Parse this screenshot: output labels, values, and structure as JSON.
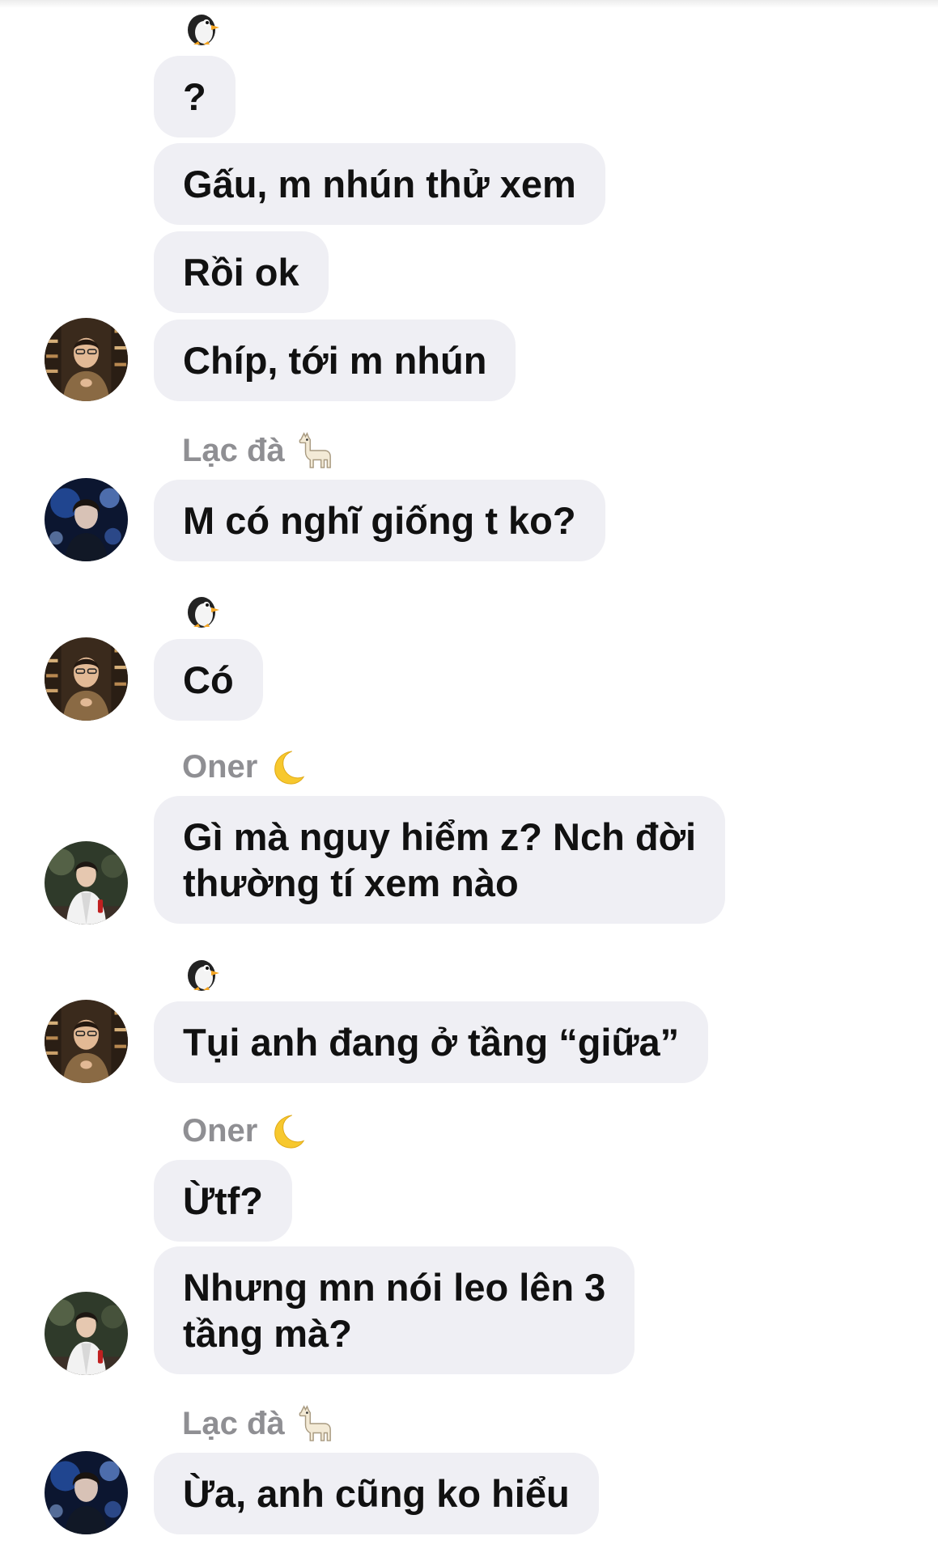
{
  "conversation": {
    "groups": [
      {
        "sender": {
          "name": "",
          "emoji": "penguin-icon"
        },
        "messages": [
          {
            "text": "?"
          },
          {
            "text": "Gấu, m nhún thử xem"
          },
          {
            "text": "Rồi ok"
          },
          {
            "text": "Chíp, tới m nhún"
          }
        ],
        "avatar": "brown-sweater-avatar"
      },
      {
        "sender": {
          "name": "Lạc đà",
          "emoji": "llama-icon"
        },
        "messages": [
          {
            "text": "M có nghĩ giống t ko?"
          }
        ],
        "avatar": "blue-light-avatar"
      },
      {
        "sender": {
          "name": "",
          "emoji": "penguin-icon"
        },
        "messages": [
          {
            "text": "Có"
          }
        ],
        "avatar": "brown-sweater-avatar"
      },
      {
        "sender": {
          "name": "Oner",
          "emoji": "crescent-moon-icon"
        },
        "messages": [
          {
            "line1": "Gì mà nguy hiểm z? Nch đời",
            "line2": "thường tí xem nào"
          }
        ],
        "avatar": "white-jacket-avatar"
      },
      {
        "sender": {
          "name": "",
          "emoji": "penguin-icon"
        },
        "messages": [
          {
            "text": "Tụi anh đang ở tầng “giữa”"
          }
        ],
        "avatar": "brown-sweater-avatar"
      },
      {
        "sender": {
          "name": "Oner",
          "emoji": "crescent-moon-icon"
        },
        "messages": [
          {
            "text": "Ừtf?"
          },
          {
            "line1": "Nhưng mn nói leo lên 3",
            "line2": "tầng mà?"
          }
        ],
        "avatar": "white-jacket-avatar"
      },
      {
        "sender": {
          "name": "Lạc đà",
          "emoji": "llama-icon"
        },
        "messages": [
          {
            "text": "Ừa, anh cũng ko hiểu"
          }
        ],
        "avatar": "blue-light-avatar"
      }
    ]
  },
  "colors": {
    "bubble_bg": "#efeff4",
    "message_text": "#111111",
    "sender_name": "#8f8f93",
    "page_bg": "#ffffff"
  }
}
